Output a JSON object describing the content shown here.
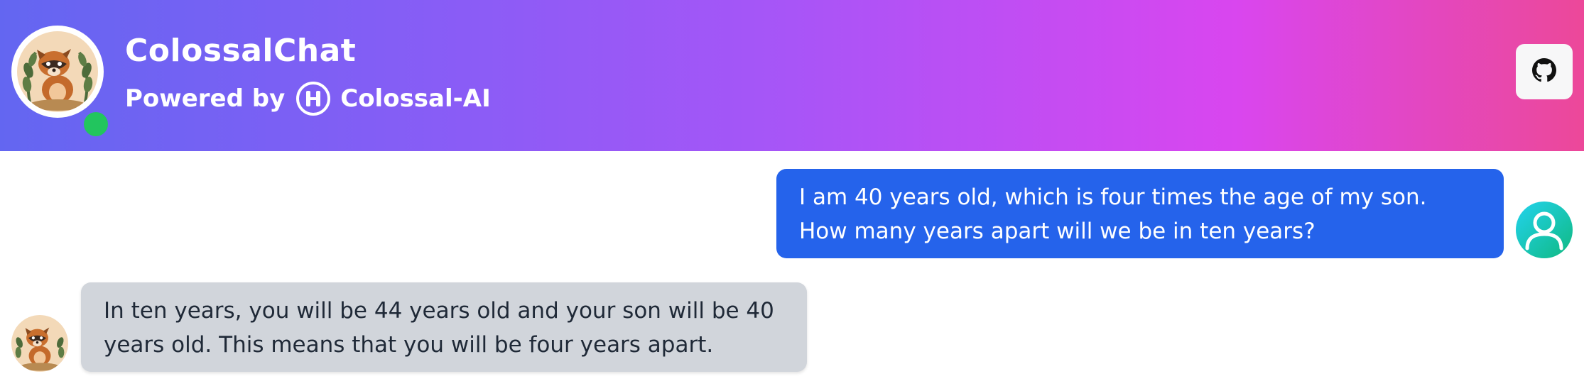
{
  "header": {
    "title": "ColossalChat",
    "powered_by": "Powered by",
    "brand": "Colossal-AI",
    "status": "online",
    "colors": {
      "gradient_start": "#6366f1",
      "gradient_mid": "#a855f7",
      "gradient_end": "#ec4899",
      "status": "#22c55e"
    }
  },
  "toolbar": {
    "github_icon": "github-icon"
  },
  "messages": [
    {
      "role": "user",
      "text": "I am 40 years old, which is four times the age of my son. How many years apart will we be in ten years?",
      "bubble_color": "#2563eb"
    },
    {
      "role": "assistant",
      "text": "In ten years, you will be 44 years old and your son will be 40 years old. This means that you will be four years apart.",
      "bubble_color": "#d1d5db"
    }
  ]
}
